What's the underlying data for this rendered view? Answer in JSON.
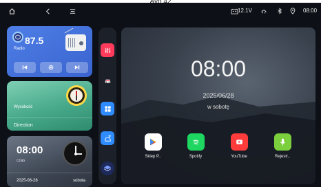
{
  "window": {
    "title": "Ayo 42"
  },
  "statusbar": {
    "voltage": "12.1V",
    "time": "08:00"
  },
  "radio_widget": {
    "frequency": "87.5",
    "label": "Radio"
  },
  "direction_widget": {
    "altitude_label": "Wysokość",
    "label": "Direction"
  },
  "clock_widget": {
    "time": "08:00",
    "label": "czas",
    "date": "2025-06-28",
    "weekday": "sobota"
  },
  "home": {
    "time": "08:00",
    "date": "2025/06/28",
    "weekday": "w sobotę"
  },
  "apps": [
    {
      "label": "Sklep P..",
      "icon": "play-store-icon",
      "color": "#ffffff"
    },
    {
      "label": "Spotify",
      "icon": "spotify-icon",
      "color": "#1ed760"
    },
    {
      "label": "YouTube",
      "icon": "youtube-icon",
      "color": "#ff3b3b"
    },
    {
      "label": "Rejestr..",
      "icon": "microphone-icon",
      "color": "#7ccf3c"
    }
  ],
  "dock": [
    {
      "icon": "equalizer-icon",
      "color": "#ff3b5c"
    },
    {
      "icon": "car-icon",
      "color": "#ffffff"
    },
    {
      "icon": "apps-grid-icon",
      "color": "#2f8cff"
    },
    {
      "icon": "car-settings-icon",
      "color": "#2f8cff"
    },
    {
      "icon": "layers-icon",
      "color": "#3d5bd9"
    }
  ]
}
